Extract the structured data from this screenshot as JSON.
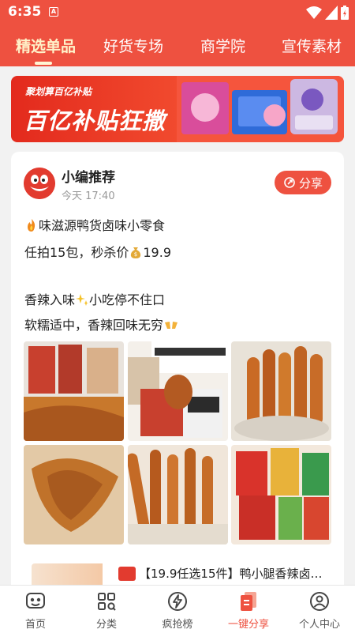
{
  "status": {
    "time": "6:35",
    "indicator": "A"
  },
  "tabs": [
    {
      "label": "精选单品",
      "active": true
    },
    {
      "label": "好货专场",
      "active": false
    },
    {
      "label": "商学院",
      "active": false
    },
    {
      "label": "宣传素材",
      "active": false
    }
  ],
  "banner": {
    "subtitle": "聚划算百亿补贴",
    "title": "百亿补贴狂撒"
  },
  "post": {
    "author": "小编推荐",
    "time": "今天 17:40",
    "share_label": "分享",
    "lines": [
      "味滋源鸭货卤味小零食",
      "任拍15包，秒杀价",
      "19.9",
      "香辣入味",
      "小吃停不住口",
      "软糯适中，香辣回味无穷"
    ]
  },
  "product": {
    "title": "【19.9任选15件】鸭小腿香辣卤味..."
  },
  "nav": [
    {
      "label": "首页",
      "icon": "home-icon"
    },
    {
      "label": "分类",
      "icon": "category-icon"
    },
    {
      "label": "疯抢榜",
      "icon": "lightning-icon"
    },
    {
      "label": "一键分享",
      "icon": "share-doc-icon",
      "active": true
    },
    {
      "label": "个人中心",
      "icon": "person-icon"
    }
  ],
  "colors": {
    "brand": "#ee5140",
    "active_tab": "#fff2c9"
  }
}
